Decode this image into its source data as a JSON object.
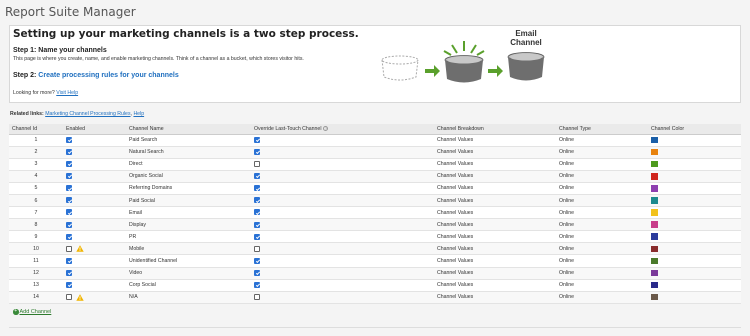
{
  "app_title": "Report Suite Manager",
  "intro": {
    "heading": "Setting up your marketing channels is a two step process.",
    "step1_title": "Step 1: Name your channels",
    "step1_desc": "This page is where you create, name, and enable marketing channels. Think of a channel as a bucket, which stores visitor hits.",
    "step2_prefix": "Step 2: ",
    "step2_link": "Create processing rules for your channels",
    "more_prefix": "Looking for more? ",
    "more_link": "Visit Help",
    "illustration_label": "Email Channel"
  },
  "related": {
    "label": "Related links:",
    "link1": "Marketing Channel Processing Rules",
    "sep": ", ",
    "link2": "Help"
  },
  "table": {
    "headers": {
      "id": "Channel Id",
      "enabled": "Enabled",
      "name": "Channel Name",
      "override": "Override Last-Touch Channel",
      "breakdown": "Channel Breakdown",
      "type": "Channel Type",
      "color": "Channel Color"
    },
    "rows": [
      {
        "id": "1",
        "enabled": true,
        "warn": false,
        "name": "Paid Search",
        "override": true,
        "breakdown": "Channel Values",
        "type": "Online",
        "color": "#1a5fa8"
      },
      {
        "id": "2",
        "enabled": true,
        "warn": false,
        "name": "Natural Search",
        "override": true,
        "breakdown": "Channel Values",
        "type": "Online",
        "color": "#e8830f"
      },
      {
        "id": "3",
        "enabled": true,
        "warn": false,
        "name": "Direct",
        "override": false,
        "breakdown": "Channel Values",
        "type": "Online",
        "color": "#4e9a1d"
      },
      {
        "id": "4",
        "enabled": true,
        "warn": false,
        "name": "Organic Social",
        "override": true,
        "breakdown": "Channel Values",
        "type": "Online",
        "color": "#d0261d"
      },
      {
        "id": "5",
        "enabled": true,
        "warn": false,
        "name": "Referring Domains",
        "override": true,
        "breakdown": "Channel Values",
        "type": "Online",
        "color": "#8e3fb0"
      },
      {
        "id": "6",
        "enabled": true,
        "warn": false,
        "name": "Paid Social",
        "override": true,
        "breakdown": "Channel Values",
        "type": "Online",
        "color": "#1c8a8e"
      },
      {
        "id": "7",
        "enabled": true,
        "warn": false,
        "name": "Email",
        "override": true,
        "breakdown": "Channel Values",
        "type": "Online",
        "color": "#f2c21b"
      },
      {
        "id": "8",
        "enabled": true,
        "warn": false,
        "name": "Display",
        "override": true,
        "breakdown": "Channel Values",
        "type": "Online",
        "color": "#c83d8a"
      },
      {
        "id": "9",
        "enabled": true,
        "warn": false,
        "name": "PR",
        "override": true,
        "breakdown": "Channel Values",
        "type": "Online",
        "color": "#2b3b9c"
      },
      {
        "id": "10",
        "enabled": false,
        "warn": true,
        "name": "Mobile",
        "override": false,
        "breakdown": "Channel Values",
        "type": "Online",
        "color": "#8a2d2d"
      },
      {
        "id": "11",
        "enabled": true,
        "warn": false,
        "name": "Unidentified Channel",
        "override": true,
        "breakdown": "Channel Values",
        "type": "Online",
        "color": "#4a7a2a"
      },
      {
        "id": "12",
        "enabled": true,
        "warn": false,
        "name": "Video",
        "override": true,
        "breakdown": "Channel Values",
        "type": "Online",
        "color": "#7b3a9a"
      },
      {
        "id": "13",
        "enabled": true,
        "warn": false,
        "name": "Corp Social",
        "override": true,
        "breakdown": "Channel Values",
        "type": "Online",
        "color": "#2a2a8a"
      },
      {
        "id": "14",
        "enabled": false,
        "warn": true,
        "name": "N/A",
        "override": false,
        "breakdown": "Channel Values",
        "type": "Online",
        "color": "#6b5a4a"
      }
    ]
  },
  "add_channel": "Add Channel",
  "icons": {
    "add": "plus-circle-icon",
    "warn": "warning-triangle-icon",
    "help": "help-circle-icon"
  }
}
